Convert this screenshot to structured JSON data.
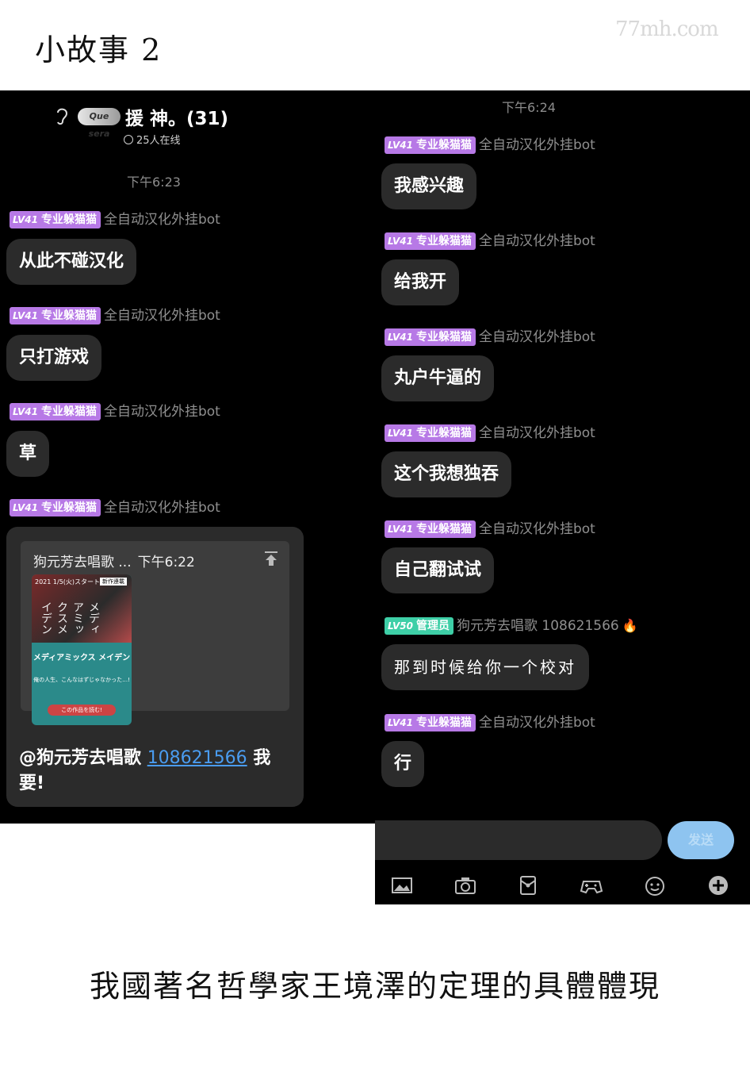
{
  "page": {
    "title": "小故事 2",
    "watermark": "77mh.com",
    "caption": "我國著名哲學家王境澤的定理的具體體現"
  },
  "left": {
    "header": {
      "logo_text": "Que sera",
      "group_name": "援 神。(31)",
      "online": "25人在线"
    },
    "time": "下午6:23",
    "messages": [
      {
        "badge_level": "LV41",
        "badge_title": "专业躲猫猫",
        "sender": "全自动汉化外挂bot",
        "text": "从此不碰汉化"
      },
      {
        "badge_level": "LV41",
        "badge_title": "专业躲猫猫",
        "sender": "全自动汉化外挂bot",
        "text": "只打游戏"
      },
      {
        "badge_level": "LV41",
        "badge_title": "专业躲猫猫",
        "sender": "全自动汉化外挂bot",
        "text": "草"
      },
      {
        "badge_level": "LV41",
        "badge_title": "专业躲猫猫",
        "sender": "全自动汉化外挂bot"
      }
    ],
    "quote": {
      "name": "狗元芳去唱歌 ...",
      "time": "下午6:22",
      "cover": {
        "date": "2021 1/5(火)スタート!!",
        "tag": "新作連載",
        "jp": "メディアミックスメイデン",
        "title": "メディアミックス メイデン",
        "line": "俺の人生、こんなはずじゃなかった…!",
        "button": "この作品を読む!"
      },
      "mention_name": "@狗元芳去唱歌",
      "mention_qq": "108621566",
      "mention_text": "我要!"
    }
  },
  "right": {
    "time": "下午6:24",
    "messages": [
      {
        "badge_level": "LV41",
        "badge_title": "专业躲猫猫",
        "sender": "全自动汉化外挂bot",
        "text": "我感兴趣"
      },
      {
        "badge_level": "LV41",
        "badge_title": "专业躲猫猫",
        "sender": "全自动汉化外挂bot",
        "text": "给我开"
      },
      {
        "badge_level": "LV41",
        "badge_title": "专业躲猫猫",
        "sender": "全自动汉化外挂bot",
        "text": "丸户牛逼的"
      },
      {
        "badge_level": "LV41",
        "badge_title": "专业躲猫猫",
        "sender": "全自动汉化外挂bot",
        "text": "这个我想独吞"
      },
      {
        "badge_level": "LV41",
        "badge_title": "专业躲猫猫",
        "sender": "全自动汉化外挂bot",
        "text": "自己翻试试"
      },
      {
        "badge_level": "LV50",
        "badge_title": "管理员",
        "sender": "狗元芳去唱歌 108621566",
        "text": "那到时候给你一个校对"
      },
      {
        "badge_level": "LV41",
        "badge_title": "专业躲猫猫",
        "sender": "全自动汉化外挂bot",
        "text": "行"
      }
    ],
    "send_label": "发送",
    "toolbar": [
      "image-icon",
      "camera-icon",
      "red-packet-icon",
      "gamepad-icon",
      "emoji-icon",
      "plus-icon"
    ]
  },
  "colors": {
    "badge_member": "#b779e6",
    "badge_admin": "#3ecfa7",
    "bubble": "#2b2b2b",
    "send_button": "#8ec4f0",
    "link": "#4a9cf0"
  }
}
